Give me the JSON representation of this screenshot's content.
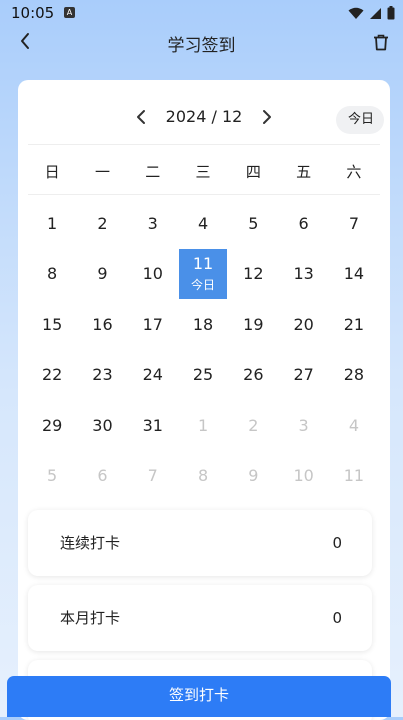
{
  "status_bar": {
    "time": "10:05",
    "notif_letter": "A"
  },
  "header": {
    "title": "学习签到"
  },
  "calendar": {
    "month_label": "2024 / 12",
    "today_button": "今日",
    "weekdays": [
      "日",
      "一",
      "二",
      "三",
      "四",
      "五",
      "六"
    ],
    "days": [
      {
        "n": "1"
      },
      {
        "n": "2"
      },
      {
        "n": "3"
      },
      {
        "n": "4"
      },
      {
        "n": "5"
      },
      {
        "n": "6"
      },
      {
        "n": "7"
      },
      {
        "n": "8"
      },
      {
        "n": "9"
      },
      {
        "n": "10"
      },
      {
        "n": "11",
        "today": true,
        "sub": "今日"
      },
      {
        "n": "12"
      },
      {
        "n": "13"
      },
      {
        "n": "14"
      },
      {
        "n": "15"
      },
      {
        "n": "16"
      },
      {
        "n": "17"
      },
      {
        "n": "18"
      },
      {
        "n": "19"
      },
      {
        "n": "20"
      },
      {
        "n": "21"
      },
      {
        "n": "22"
      },
      {
        "n": "23"
      },
      {
        "n": "24"
      },
      {
        "n": "25"
      },
      {
        "n": "26"
      },
      {
        "n": "27"
      },
      {
        "n": "28"
      },
      {
        "n": "29"
      },
      {
        "n": "30"
      },
      {
        "n": "31"
      },
      {
        "n": "1",
        "muted": true
      },
      {
        "n": "2",
        "muted": true
      },
      {
        "n": "3",
        "muted": true
      },
      {
        "n": "4",
        "muted": true
      },
      {
        "n": "5",
        "muted": true
      },
      {
        "n": "6",
        "muted": true
      },
      {
        "n": "7",
        "muted": true
      },
      {
        "n": "8",
        "muted": true
      },
      {
        "n": "9",
        "muted": true
      },
      {
        "n": "10",
        "muted": true
      },
      {
        "n": "11",
        "muted": true
      }
    ]
  },
  "stats": [
    {
      "label": "连续打卡",
      "value": "0"
    },
    {
      "label": "本月打卡",
      "value": "0"
    }
  ],
  "checkin_button": "签到打卡",
  "colors": {
    "accent": "#2d7cf6",
    "today_bg": "#4a90e8",
    "muted_text": "#c6c6c6"
  }
}
